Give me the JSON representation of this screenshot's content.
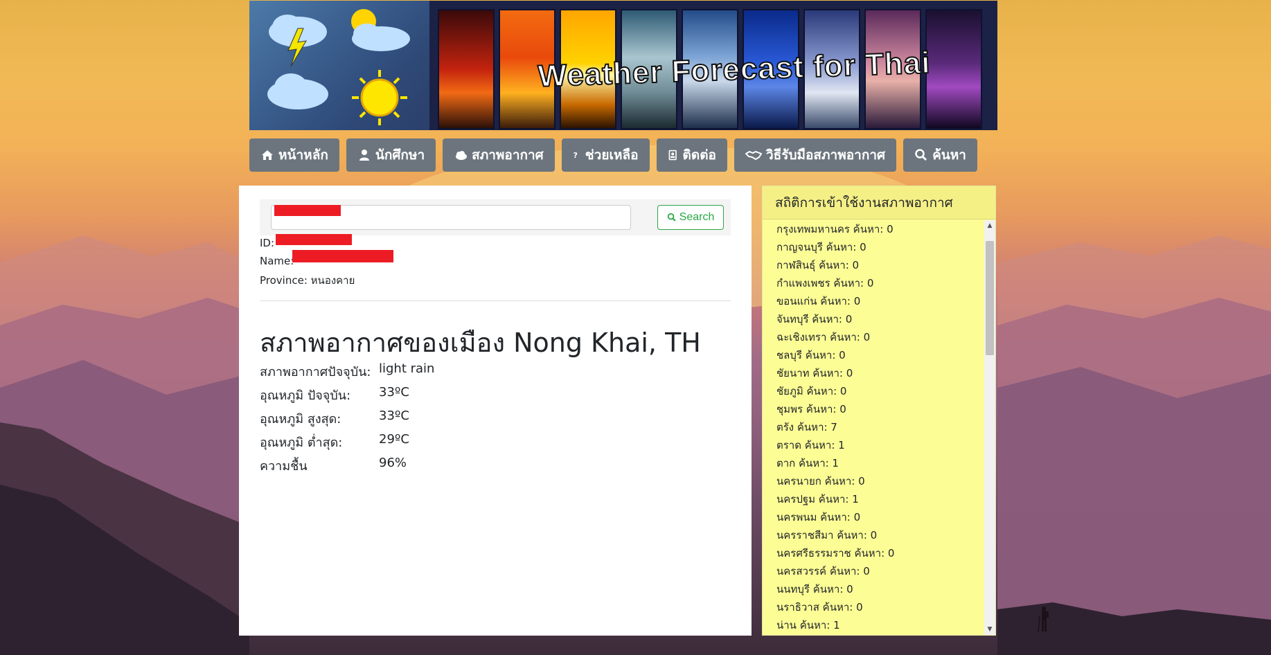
{
  "banner": {
    "title": "Weather Forecast for Thai"
  },
  "nav": {
    "items": [
      {
        "label": "หน้าหลัก",
        "icon": "home-icon"
      },
      {
        "label": "นักศึกษา",
        "icon": "user-icon"
      },
      {
        "label": "สภาพอากาศ",
        "icon": "cloud-icon"
      },
      {
        "label": "ช่วยเหลือ",
        "icon": "question-icon"
      },
      {
        "label": "ติดต่อ",
        "icon": "contact-card-icon"
      },
      {
        "label": "วิธีรับมือสภาพอากาศ",
        "icon": "handshake-icon"
      },
      {
        "label": "ค้นหา",
        "icon": "search-icon"
      }
    ]
  },
  "search": {
    "button_label": "Search",
    "button_icon": "search-icon"
  },
  "student": {
    "id_label": "ID:",
    "name_label": "Name:",
    "province_label": "Province:",
    "province_value": "หนองคาย"
  },
  "weather": {
    "heading": "สภาพอากาศของเมือง Nong Khai, TH",
    "rows": [
      {
        "label": "สภาพอากาศปัจจุบัน:",
        "value": "light rain"
      },
      {
        "label": "อุณหภูมิ ปัจจุบัน:",
        "value": "33ºC"
      },
      {
        "label": "อุณหภูมิ สูงสุด:",
        "value": "33ºC"
      },
      {
        "label": "อุณหภูมิ ต่ำสุด:",
        "value": "29ºC"
      },
      {
        "label": "ความชื้น",
        "value": "96%"
      }
    ]
  },
  "stats": {
    "title": "สถิติการเข้าใช้งานสภาพอากาศ",
    "items": [
      "กรุงเทพมหานคร ค้นหา: 0",
      "กาญจนบุรี ค้นหา: 0",
      "กาฬสินธุ์ ค้นหา: 0",
      "กำแพงเพชร ค้นหา: 0",
      "ขอนแก่น ค้นหา: 0",
      "จันทบุรี ค้นหา: 0",
      "ฉะเชิงเทรา ค้นหา: 0",
      "ชลบุรี ค้นหา: 0",
      "ชัยนาท ค้นหา: 0",
      "ชัยภูมิ ค้นหา: 0",
      "ชุมพร ค้นหา: 0",
      "ตรัง ค้นหา: 7",
      "ตราด ค้นหา: 1",
      "ตาก ค้นหา: 1",
      "นครนายก ค้นหา: 0",
      "นครปฐม ค้นหา: 1",
      "นครพนม ค้นหา: 0",
      "นครราชสีมา ค้นหา: 0",
      "นครศรีธรรมราช ค้นหา: 0",
      "นครสวรรค์ ค้นหา: 0",
      "นนทบุรี ค้นหา: 0",
      "นราธิวาส ค้นหา: 0",
      "น่าน ค้นหา: 1"
    ]
  },
  "colors": {
    "nav_button": "#6c757d",
    "search_green": "#28a745",
    "stats_bg": "#fdfd96",
    "redaction": "#ed1c24"
  }
}
